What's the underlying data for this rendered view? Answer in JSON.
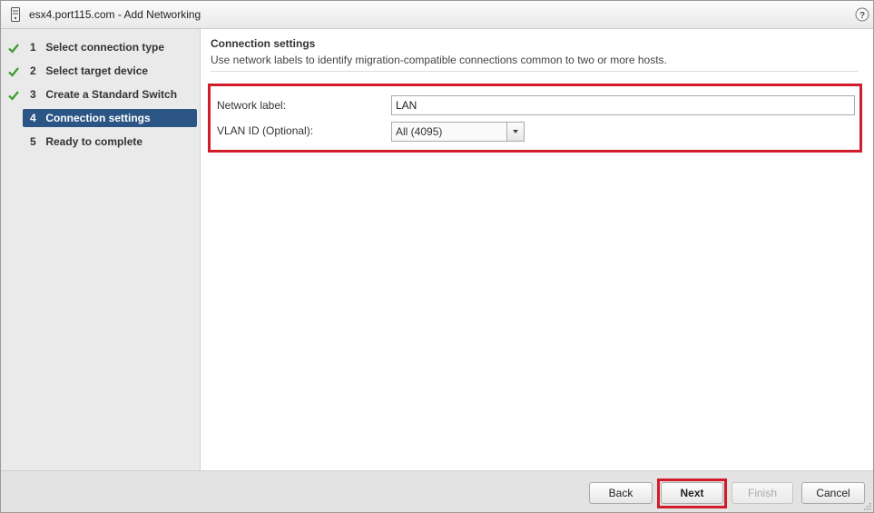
{
  "window": {
    "title": "esx4.port115.com - Add Networking",
    "title_icon": "server-icon",
    "help_icon": "help-icon"
  },
  "steps": [
    {
      "num": "1",
      "label": "Select connection type",
      "status": "complete"
    },
    {
      "num": "2",
      "label": "Select target device",
      "status": "complete"
    },
    {
      "num": "3",
      "label": "Create a Standard Switch",
      "status": "complete"
    },
    {
      "num": "4",
      "label": "Connection settings",
      "status": "active"
    },
    {
      "num": "5",
      "label": "Ready to complete",
      "status": "pending"
    }
  ],
  "main": {
    "section_title": "Connection settings",
    "section_description": "Use network labels to identify migration-compatible connections common to two or more hosts.",
    "network_label": {
      "label": "Network label:",
      "value": "LAN"
    },
    "vlan_id": {
      "label": "VLAN ID (Optional):",
      "value": "All (4095)"
    }
  },
  "footer": {
    "back": "Back",
    "next": "Next",
    "finish": "Finish",
    "cancel": "Cancel"
  },
  "colors": {
    "active_step": "#2b5585",
    "highlight": "#d11c2a",
    "check": "#3c9a2e"
  }
}
